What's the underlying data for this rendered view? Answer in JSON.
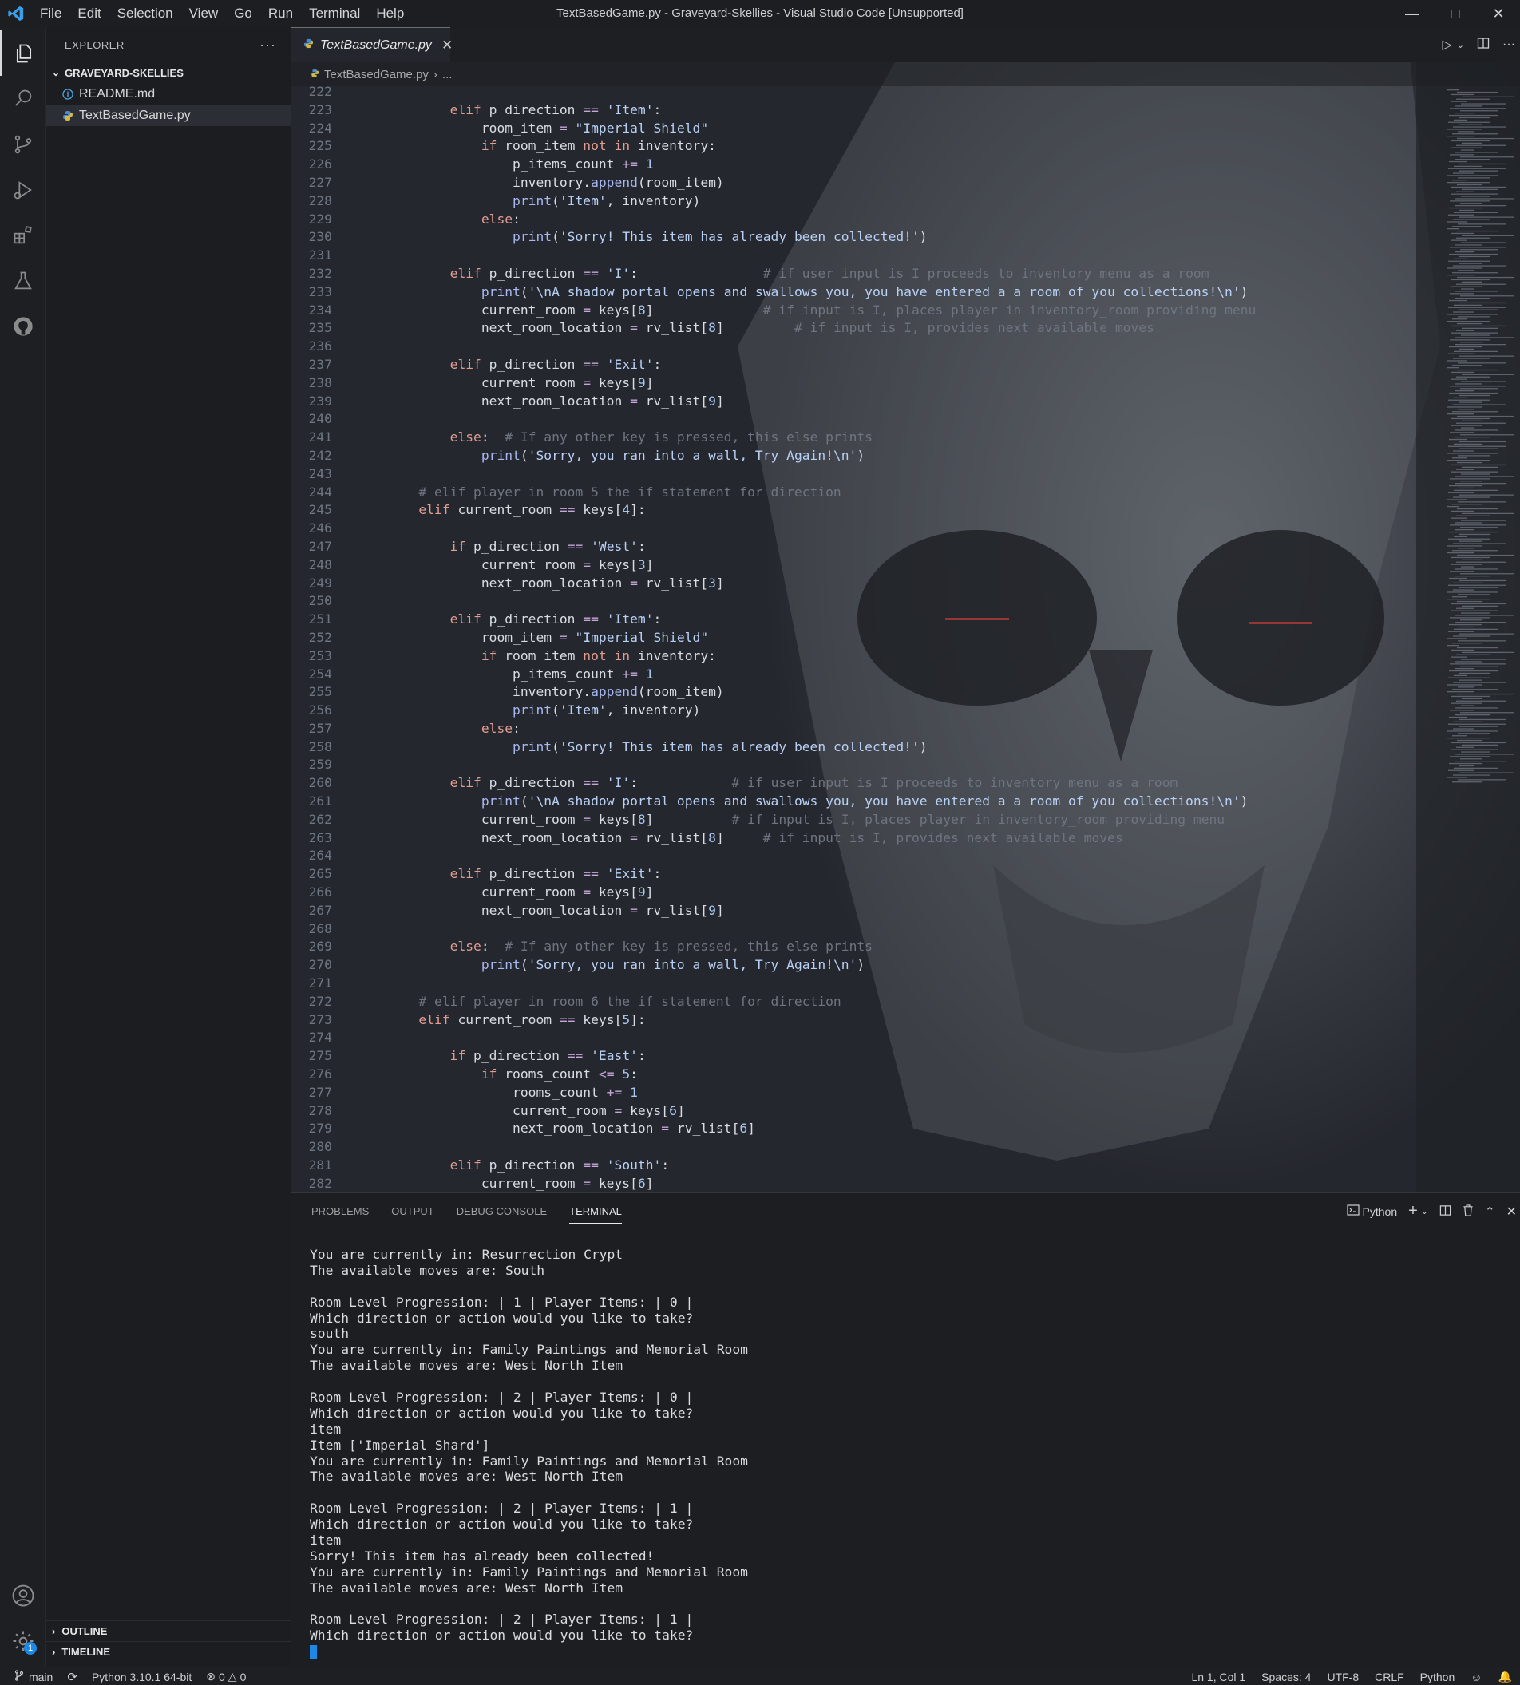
{
  "titlebar": {
    "title": "TextBasedGame.py - Graveyard-Skellies - Visual Studio Code [Unsupported]",
    "menus": [
      "File",
      "Edit",
      "Selection",
      "View",
      "Go",
      "Run",
      "Terminal",
      "Help"
    ]
  },
  "sidebar": {
    "header": "EXPLORER",
    "folder": "GRAVEYARD-SKELLIES",
    "files": [
      {
        "name": "README.md",
        "icon": "info-icon"
      },
      {
        "name": "TextBasedGame.py",
        "icon": "python-icon"
      }
    ],
    "outline": "OUTLINE",
    "timeline": "TIMELINE"
  },
  "editor": {
    "tab": "TextBasedGame.py",
    "breadcrumb_file": "TextBasedGame.py",
    "breadcrumb_more": "...",
    "lines": [
      {
        "n": "222",
        "c": ""
      },
      {
        "n": "223",
        "c": "            <span class='kw'>elif</span> p_direction <span class='op'>==</span> <span class='str'>'Item'</span>:"
      },
      {
        "n": "224",
        "c": "                room_item <span class='op'>=</span> <span class='str'>\"Imperial Shield\"</span>"
      },
      {
        "n": "225",
        "c": "                <span class='kw'>if</span> room_item <span class='kw'>not in</span> inventory:"
      },
      {
        "n": "226",
        "c": "                    p_items_count <span class='op'>+=</span> <span class='nm'>1</span>"
      },
      {
        "n": "227",
        "c": "                    inventory.<span class='fn'>append</span>(room_item)"
      },
      {
        "n": "228",
        "c": "                    <span class='fn'>print</span>(<span class='str'>'Item'</span>, inventory)"
      },
      {
        "n": "229",
        "c": "                <span class='kw'>else</span>:"
      },
      {
        "n": "230",
        "c": "                    <span class='fn'>print</span>(<span class='str'>'Sorry! This item has already been collected!'</span>)"
      },
      {
        "n": "231",
        "c": ""
      },
      {
        "n": "232",
        "c": "            <span class='kw'>elif</span> p_direction <span class='op'>==</span> <span class='str'>'I'</span>:                <span class='cm'># if user input is I proceeds to inventory menu as a room</span>"
      },
      {
        "n": "233",
        "c": "                <span class='fn'>print</span>(<span class='str'>'\\nA shadow portal opens and swallows you, you have entered a a room of you collections!\\n'</span>)"
      },
      {
        "n": "234",
        "c": "                current_room <span class='op'>=</span> keys[<span class='nm'>8</span>]              <span class='cm'># if input is I, places player in inventory_room providing menu</span>"
      },
      {
        "n": "235",
        "c": "                next_room_location <span class='op'>=</span> rv_list[<span class='nm'>8</span>]         <span class='cm'># if input is I, provides next available moves</span>"
      },
      {
        "n": "236",
        "c": ""
      },
      {
        "n": "237",
        "c": "            <span class='kw'>elif</span> p_direction <span class='op'>==</span> <span class='str'>'Exit'</span>:"
      },
      {
        "n": "238",
        "c": "                current_room <span class='op'>=</span> keys[<span class='nm'>9</span>]"
      },
      {
        "n": "239",
        "c": "                next_room_location <span class='op'>=</span> rv_list[<span class='nm'>9</span>]"
      },
      {
        "n": "240",
        "c": ""
      },
      {
        "n": "241",
        "c": "            <span class='kw'>else</span>:  <span class='cm'># If any other key is pressed, this else prints</span>"
      },
      {
        "n": "242",
        "c": "                <span class='fn'>print</span>(<span class='str'>'Sorry, you ran into a wall, Try Again!\\n'</span>)"
      },
      {
        "n": "243",
        "c": ""
      },
      {
        "n": "244",
        "c": "        <span class='cm'># elif player in room 5 the if statement for direction</span>"
      },
      {
        "n": "245",
        "c": "        <span class='kw'>elif</span> current_room <span class='op'>==</span> keys[<span class='nm'>4</span>]:"
      },
      {
        "n": "246",
        "c": ""
      },
      {
        "n": "247",
        "c": "            <span class='kw'>if</span> p_direction <span class='op'>==</span> <span class='str'>'West'</span>:"
      },
      {
        "n": "248",
        "c": "                current_room <span class='op'>=</span> keys[<span class='nm'>3</span>]"
      },
      {
        "n": "249",
        "c": "                next_room_location <span class='op'>=</span> rv_list[<span class='nm'>3</span>]"
      },
      {
        "n": "250",
        "c": ""
      },
      {
        "n": "251",
        "c": "            <span class='kw'>elif</span> p_direction <span class='op'>==</span> <span class='str'>'Item'</span>:"
      },
      {
        "n": "252",
        "c": "                room_item <span class='op'>=</span> <span class='str'>\"Imperial Shield\"</span>"
      },
      {
        "n": "253",
        "c": "                <span class='kw'>if</span> room_item <span class='kw'>not in</span> inventory:"
      },
      {
        "n": "254",
        "c": "                    p_items_count <span class='op'>+=</span> <span class='nm'>1</span>"
      },
      {
        "n": "255",
        "c": "                    inventory.<span class='fn'>append</span>(room_item)"
      },
      {
        "n": "256",
        "c": "                    <span class='fn'>print</span>(<span class='str'>'Item'</span>, inventory)"
      },
      {
        "n": "257",
        "c": "                <span class='kw'>else</span>:"
      },
      {
        "n": "258",
        "c": "                    <span class='fn'>print</span>(<span class='str'>'Sorry! This item has already been collected!'</span>)"
      },
      {
        "n": "259",
        "c": ""
      },
      {
        "n": "260",
        "c": "            <span class='kw'>elif</span> p_direction <span class='op'>==</span> <span class='str'>'I'</span>:            <span class='cm'># if user input is I proceeds to inventory menu as a room</span>"
      },
      {
        "n": "261",
        "c": "                <span class='fn'>print</span>(<span class='str'>'\\nA shadow portal opens and swallows you, you have entered a a room of you collections!\\n'</span>)"
      },
      {
        "n": "262",
        "c": "                current_room <span class='op'>=</span> keys[<span class='nm'>8</span>]          <span class='cm'># if input is I, places player in inventory_room providing menu</span>"
      },
      {
        "n": "263",
        "c": "                next_room_location <span class='op'>=</span> rv_list[<span class='nm'>8</span>]     <span class='cm'># if input is I, provides next available moves</span>"
      },
      {
        "n": "264",
        "c": ""
      },
      {
        "n": "265",
        "c": "            <span class='kw'>elif</span> p_direction <span class='op'>==</span> <span class='str'>'Exit'</span>:"
      },
      {
        "n": "266",
        "c": "                current_room <span class='op'>=</span> keys[<span class='nm'>9</span>]"
      },
      {
        "n": "267",
        "c": "                next_room_location <span class='op'>=</span> rv_list[<span class='nm'>9</span>]"
      },
      {
        "n": "268",
        "c": ""
      },
      {
        "n": "269",
        "c": "            <span class='kw'>else</span>:  <span class='cm'># If any other key is pressed, this else prints</span>"
      },
      {
        "n": "270",
        "c": "                <span class='fn'>print</span>(<span class='str'>'Sorry, you ran into a wall, Try Again!\\n'</span>)"
      },
      {
        "n": "271",
        "c": ""
      },
      {
        "n": "272",
        "c": "        <span class='cm'># elif player in room 6 the if statement for direction</span>"
      },
      {
        "n": "273",
        "c": "        <span class='kw'>elif</span> current_room <span class='op'>==</span> keys[<span class='nm'>5</span>]:"
      },
      {
        "n": "274",
        "c": ""
      },
      {
        "n": "275",
        "c": "            <span class='kw'>if</span> p_direction <span class='op'>==</span> <span class='str'>'East'</span>:"
      },
      {
        "n": "276",
        "c": "                <span class='kw'>if</span> rooms_count <span class='op'><=</span> <span class='nm'>5</span>:"
      },
      {
        "n": "277",
        "c": "                    rooms_count <span class='op'>+=</span> <span class='nm'>1</span>"
      },
      {
        "n": "278",
        "c": "                    current_room <span class='op'>=</span> keys[<span class='nm'>6</span>]"
      },
      {
        "n": "279",
        "c": "                    next_room_location <span class='op'>=</span> rv_list[<span class='nm'>6</span>]"
      },
      {
        "n": "280",
        "c": ""
      },
      {
        "n": "281",
        "c": "            <span class='kw'>elif</span> p_direction <span class='op'>==</span> <span class='str'>'South'</span>:"
      },
      {
        "n": "282",
        "c": "                current_room <span class='op'>=</span> keys[<span class='nm'>6</span>]"
      }
    ]
  },
  "panel": {
    "tabs": [
      "PROBLEMS",
      "OUTPUT",
      "DEBUG CONSOLE",
      "TERMINAL"
    ],
    "active_tab": "TERMINAL",
    "shell": "Python",
    "terminal_lines": [
      "You are currently in: Resurrection Crypt",
      "The available moves are: South",
      "",
      "Room Level Progression: | 1 | Player Items: | 0 |",
      "Which direction or action would you like to take?",
      "south",
      "You are currently in: Family Paintings and Memorial Room",
      "The available moves are: West North Item",
      "",
      "Room Level Progression: | 2 | Player Items: | 0 |",
      "Which direction or action would you like to take?",
      "item",
      "Item ['Imperial Shard']",
      "You are currently in: Family Paintings and Memorial Room",
      "The available moves are: West North Item",
      "",
      "Room Level Progression: | 2 | Player Items: | 1 |",
      "Which direction or action would you like to take?",
      "item",
      "Sorry! This item has already been collected!",
      "You are currently in: Family Paintings and Memorial Room",
      "The available moves are: West North Item",
      "",
      "Room Level Progression: | 2 | Player Items: | 1 |",
      "Which direction or action would you like to take?"
    ]
  },
  "statusbar": {
    "branch": "main",
    "interpreter": "Python 3.10.1 64-bit",
    "errors": "0",
    "warnings": "0",
    "position": "Ln 1, Col 1",
    "spaces": "Spaces: 4",
    "encoding": "UTF-8",
    "eol": "CRLF",
    "language": "Python",
    "settings_badge": "1"
  },
  "colors": {
    "accent": "#1e88e5",
    "python_icon": "#4e8ac8",
    "readme_icon": "#4fa3e0"
  }
}
